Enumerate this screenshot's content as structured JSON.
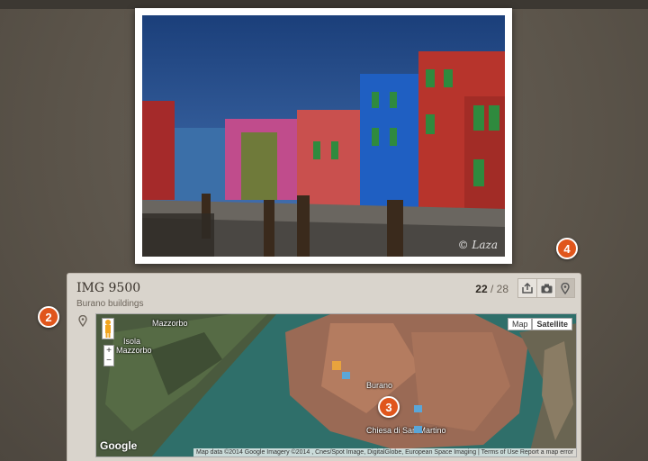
{
  "photo": {
    "watermark": "© Laza"
  },
  "info": {
    "title": "IMG 9500",
    "subtitle": "Burano buildings"
  },
  "counter": {
    "current": "22",
    "separator": " / ",
    "total": "28"
  },
  "buttons": {
    "share_icon": "share-icon",
    "camera_icon": "camera-icon",
    "location_icon": "location-pin-icon"
  },
  "map": {
    "type_buttons": [
      "Map",
      "Satellite"
    ],
    "labels": {
      "mazzorbo": "Mazzorbo",
      "isola": "Isola",
      "isola2": "Mazzorbo",
      "burano": "Burano",
      "chiesa": "Chiesa di San Martino"
    },
    "zoom_in": "+",
    "zoom_out": "−",
    "logo": "Google",
    "attribution": "Map data ©2014 Google Imagery ©2014 , Cnes/Spot Image, DigitalGlobe, European Space Imaging | Terms of Use   Report a map error"
  },
  "callouts": [
    "2",
    "3",
    "4"
  ]
}
